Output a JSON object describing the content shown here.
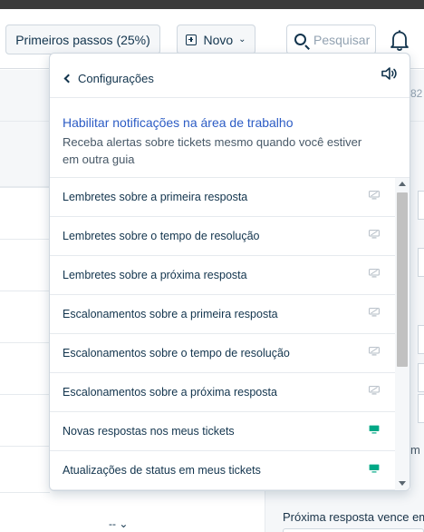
{
  "header": {
    "steps_label": "Primeiros passos (25%)",
    "new_label": "Novo",
    "search_placeholder": "Pesquisar"
  },
  "background": {
    "side_number": "82",
    "due_label": "Próxima resposta vence em",
    "side_letter": "m",
    "dash": "-- ⌄"
  },
  "popup": {
    "back_label": "Configurações",
    "enable_link": "Habilitar notificações na área de trabalho",
    "enable_desc": "Receba alertas sobre tickets mesmo quando você estiver em outra guia",
    "items": [
      {
        "label": "Lembretes sobre a primeira resposta",
        "icon": "monitor-off-icon",
        "enabled": false
      },
      {
        "label": "Lembretes sobre o tempo de resolução",
        "icon": "monitor-off-icon",
        "enabled": false
      },
      {
        "label": "Lembretes sobre a próxima resposta",
        "icon": "monitor-off-icon",
        "enabled": false
      },
      {
        "label": "Escalonamentos sobre a primeira resposta",
        "icon": "monitor-off-icon",
        "enabled": false
      },
      {
        "label": "Escalonamentos sobre o tempo de resolução",
        "icon": "monitor-off-icon",
        "enabled": false
      },
      {
        "label": "Escalonamentos sobre a próxima resposta",
        "icon": "monitor-off-icon",
        "enabled": false
      },
      {
        "label": "Novas respostas nos meus tickets",
        "icon": "monitor-on-icon",
        "enabled": true
      },
      {
        "label": "Atualizações de status em meus tickets",
        "icon": "monitor-on-icon",
        "enabled": true
      }
    ]
  },
  "colors": {
    "link": "#2c5cc5",
    "enabled_icon": "#00a886",
    "disabled_icon": "#b3bcc5"
  }
}
